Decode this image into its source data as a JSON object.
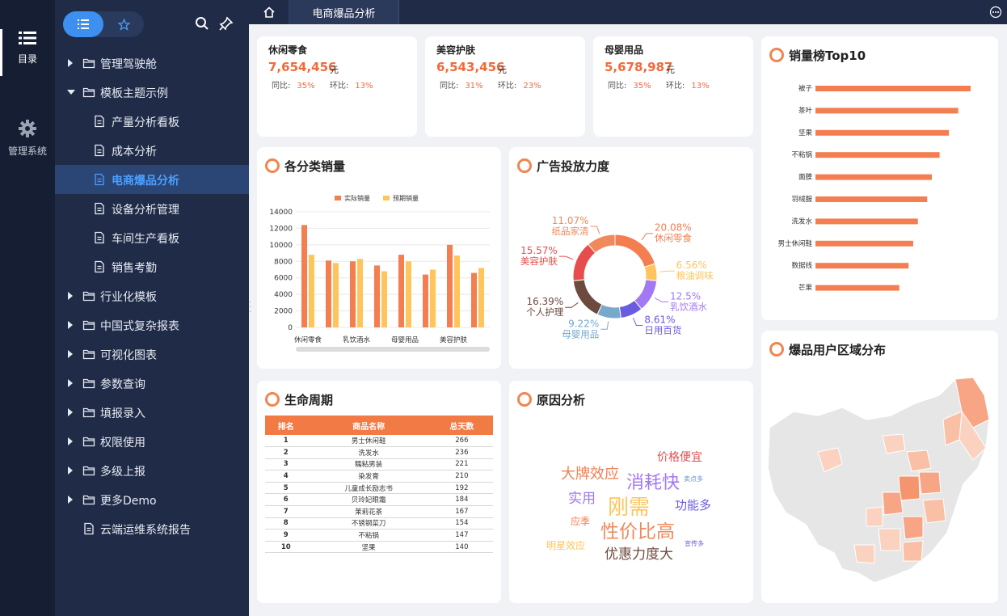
{
  "rail": {
    "items": [
      {
        "label": "目录"
      },
      {
        "label": "管理系统"
      }
    ]
  },
  "tree": {
    "rows": [
      {
        "label": "管理驾驶舱",
        "type": "folder",
        "expanded": false,
        "level": 0
      },
      {
        "label": "模板主题示例",
        "type": "folder",
        "expanded": true,
        "level": 0
      },
      {
        "label": "产量分析看板",
        "type": "file",
        "level": 1
      },
      {
        "label": "成本分析",
        "type": "file",
        "level": 1
      },
      {
        "label": "电商爆品分析",
        "type": "file",
        "level": 1,
        "selected": true
      },
      {
        "label": "设备分析管理",
        "type": "file",
        "level": 1
      },
      {
        "label": "车间生产看板",
        "type": "file",
        "level": 1
      },
      {
        "label": "销售考勤",
        "type": "file",
        "level": 1
      },
      {
        "label": "行业化模板",
        "type": "folder",
        "expanded": false,
        "level": 0
      },
      {
        "label": "中国式复杂报表",
        "type": "folder",
        "expanded": false,
        "level": 0
      },
      {
        "label": "可视化图表",
        "type": "folder",
        "expanded": false,
        "level": 0
      },
      {
        "label": "参数查询",
        "type": "folder",
        "expanded": false,
        "level": 0
      },
      {
        "label": "填报录入",
        "type": "folder",
        "expanded": false,
        "level": 0
      },
      {
        "label": "权限使用",
        "type": "folder",
        "expanded": false,
        "level": 0
      },
      {
        "label": "多级上报",
        "type": "folder",
        "expanded": false,
        "level": 0
      },
      {
        "label": "更多Demo",
        "type": "folder",
        "expanded": false,
        "level": 0
      },
      {
        "label": "云端运维系统报告",
        "type": "file",
        "level": 0
      }
    ]
  },
  "tabs": {
    "active_label": "电商爆品分析"
  },
  "kpis": [
    {
      "name": "休闲零食",
      "value": "7,654,456",
      "unit": "元",
      "yoy_label": "同比:",
      "yoy": "35%",
      "mom_label": "环比:",
      "mom": "13%"
    },
    {
      "name": "美容护肤",
      "value": "6,543,456",
      "unit": "元",
      "yoy_label": "同比:",
      "yoy": "31%",
      "mom_label": "环比:",
      "mom": "23%"
    },
    {
      "name": "母婴用品",
      "value": "5,678,987",
      "unit": "元",
      "yoy_label": "同比:",
      "yoy": "35%",
      "mom_label": "环比:",
      "mom": "13%"
    }
  ],
  "panels": {
    "sales_by_category": "各分类销量",
    "ad_intensity": "广告投放力度",
    "top10": "销量榜Top10",
    "lifecycle": "生命周期",
    "reason": "原因分析",
    "region": "爆品用户区域分布"
  },
  "colors": {
    "accent": "#f1854f",
    "bar_actual": "#f47e50",
    "bar_expected": "#ffc55c",
    "sidebar_bg": "#1f2b47",
    "rail_bg": "#161e33",
    "selected_text": "#4aa0ff"
  },
  "chart_data": [
    {
      "type": "bar",
      "title": "各分类销量",
      "categories": [
        "休闲零食",
        "",
        "乳饮酒水",
        "",
        "母婴用品",
        "",
        "美容护肤",
        ""
      ],
      "series": [
        {
          "name": "实际销量",
          "values": [
            12400,
            8100,
            8000,
            7500,
            8800,
            6400,
            10000,
            6600
          ]
        },
        {
          "name": "预期销量",
          "values": [
            8800,
            7800,
            8300,
            6800,
            8000,
            7000,
            8700,
            7200
          ]
        }
      ],
      "ylim": [
        0,
        14000
      ],
      "yticks": [
        "0",
        "2000",
        "4000",
        "6000",
        "8000",
        "10000",
        "12000",
        "14000"
      ],
      "legend": "top-center",
      "grid": true
    },
    {
      "type": "pie",
      "title": "广告投放力度",
      "slices": [
        {
          "label": "休闲零食",
          "pct": "20.08%",
          "value": 20.08,
          "color": "#f47e50"
        },
        {
          "label": "粮油调味",
          "pct": "6.56%",
          "value": 6.56,
          "color": "#ffc55c"
        },
        {
          "label": "乳饮酒水",
          "pct": "12.5%",
          "value": 12.5,
          "color": "#a279f2"
        },
        {
          "label": "日用百货",
          "pct": "8.61%",
          "value": 8.61,
          "color": "#6a5be0"
        },
        {
          "label": "母婴用品",
          "pct": "9.22%",
          "value": 9.22,
          "color": "#76a9cc"
        },
        {
          "label": "个人护理",
          "pct": "16.39%",
          "value": 16.39,
          "color": "#6d4a3e"
        },
        {
          "label": "美容护肤",
          "pct": "15.57%",
          "value": 15.57,
          "color": "#e84d4d"
        },
        {
          "label": "纸品家清",
          "pct": "11.07%",
          "value": 11.07,
          "color": "#f08a5d"
        }
      ]
    },
    {
      "type": "bar",
      "title": "销量榜Top10",
      "orientation": "horizontal",
      "categories": [
        "被子",
        "茶叶",
        "坚果",
        "不粘锅",
        "面膜",
        "羽绒服",
        "洗发水",
        "男士休闲鞋",
        "数据线",
        "芒果"
      ],
      "values": [
        100,
        92,
        86,
        80,
        75,
        72,
        66,
        63,
        60,
        54
      ],
      "xlim": [
        0,
        100
      ]
    },
    {
      "type": "table",
      "title": "生命周期",
      "columns": [
        "排名",
        "商品名称",
        "总天数"
      ],
      "rows": [
        [
          "1",
          "男士休闲鞋",
          "266"
        ],
        [
          "2",
          "洗发水",
          "236"
        ],
        [
          "3",
          "糯粘男装",
          "221"
        ],
        [
          "4",
          "染发膏",
          "210"
        ],
        [
          "5",
          "儿童成长励志书",
          "192"
        ],
        [
          "6",
          "贝玲妃眼霜",
          "184"
        ],
        [
          "7",
          "茉莉花茶",
          "167"
        ],
        [
          "8",
          "不锈钢菜刀",
          "154"
        ],
        [
          "9",
          "不粘锅",
          "147"
        ],
        [
          "10",
          "坚果",
          "140"
        ]
      ]
    }
  ],
  "word_cloud": [
    {
      "text": "价格便宜",
      "color": "#e05050",
      "size": 14
    },
    {
      "text": "大牌效应",
      "color": "#f47e50",
      "size": 18
    },
    {
      "text": "消耗快",
      "color": "#a279f2",
      "size": 22
    },
    {
      "text": "卖点多",
      "color": "#6a8bd6",
      "size": 8
    },
    {
      "text": "实用",
      "color": "#a279f2",
      "size": 17
    },
    {
      "text": "刚需",
      "color": "#ffc55c",
      "size": 26
    },
    {
      "text": "功能多",
      "color": "#6a5be0",
      "size": 15
    },
    {
      "text": "应季",
      "color": "#f47e50",
      "size": 12
    },
    {
      "text": "性价比高",
      "color": "#f08a5d",
      "size": 23
    },
    {
      "text": "明星效应",
      "color": "#ffc55c",
      "size": 12
    },
    {
      "text": "优惠力度大",
      "color": "#6d4a3e",
      "size": 17
    },
    {
      "text": "宣传多",
      "color": "#6a5be0",
      "size": 8
    }
  ]
}
